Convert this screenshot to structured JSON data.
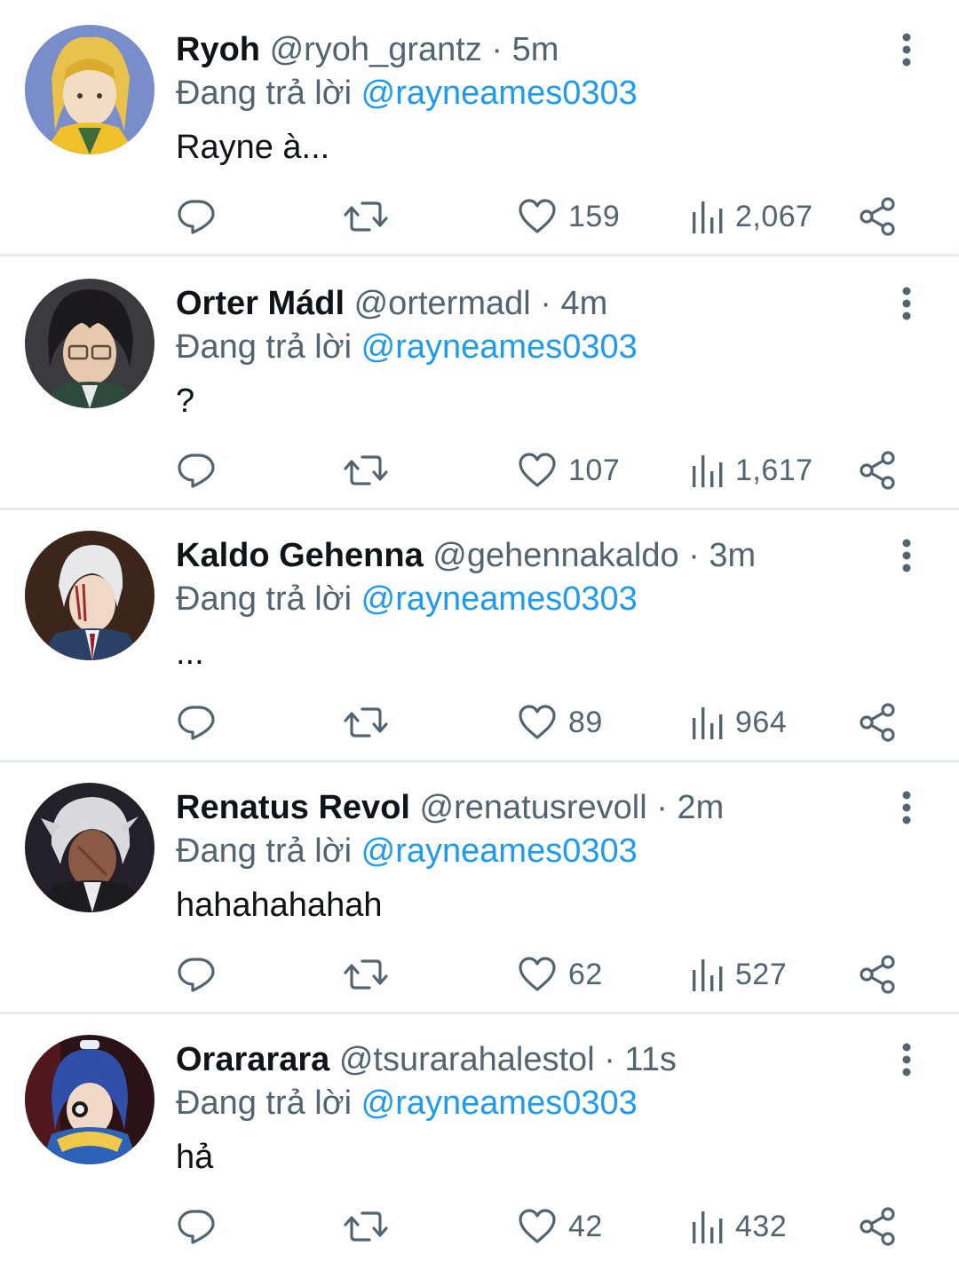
{
  "colors": {
    "accent": "#1d9bf0",
    "secondary_text": "#536471",
    "primary_text": "#0f1419",
    "divider": "#e6ecf0"
  },
  "tweets": [
    {
      "name": "Ryoh",
      "handle": "@ryoh_grantz",
      "separator": "·",
      "time": "5m",
      "reply_prefix": "Đang trả lời",
      "mention": "@rayneames0303",
      "text": "Rayne à...",
      "likes": "159",
      "views": "2,067"
    },
    {
      "name": "Orter Mádl",
      "handle": "@ortermadl",
      "separator": "·",
      "time": "4m",
      "reply_prefix": "Đang trả lời",
      "mention": "@rayneames0303",
      "text": "?",
      "likes": "107",
      "views": "1,617"
    },
    {
      "name": "Kaldo Gehenna",
      "handle": "@gehennakaldo",
      "separator": "·",
      "time": "3m",
      "reply_prefix": "Đang trả lời",
      "mention": "@rayneames0303",
      "text": "...",
      "likes": "89",
      "views": "964"
    },
    {
      "name": "Renatus Revol",
      "handle": "@renatusrevoll",
      "separator": "·",
      "time": "2m",
      "reply_prefix": "Đang trả lời",
      "mention": "@rayneames0303",
      "text": "hahahahahah",
      "likes": "62",
      "views": "527"
    },
    {
      "name": "Orararara",
      "handle": "@tsurarahalestol",
      "separator": "·",
      "time": "11s",
      "reply_prefix": "Đang trả lời",
      "mention": "@rayneames0303",
      "text": "hả",
      "likes": "42",
      "views": "432"
    }
  ],
  "icons": {
    "reply": "reply-icon",
    "retweet": "retweet-icon",
    "like": "heart-icon",
    "views": "views-icon",
    "share": "share-icon",
    "more": "more-vertical-icon"
  }
}
